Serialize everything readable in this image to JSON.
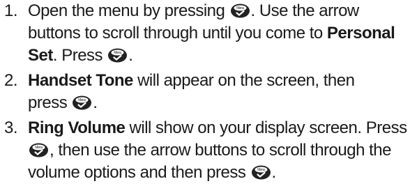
{
  "icons": {
    "menu_key": "menu-ok-key-icon",
    "menu_key_label": "Menu"
  },
  "steps": [
    {
      "number": "1.",
      "t1": "Open the menu by pressing ",
      "t2": ". Use the arrow",
      "t3": "buttons to scroll through until you come to ",
      "b1": "Personal",
      "b2": "Set",
      "t4": ". Press ",
      "t5": "."
    },
    {
      "number": "2.",
      "b1": "Handset Tone",
      "t1": " will appear on the screen, then",
      "t2": "press ",
      "t3": "."
    },
    {
      "number": "3.",
      "b1": "Ring Volume",
      "t1": " will show on your display screen. Press",
      "t2": ", then use the arrow buttons to scroll through the",
      "t3": "volume options and then press ",
      "t4": "."
    }
  ]
}
